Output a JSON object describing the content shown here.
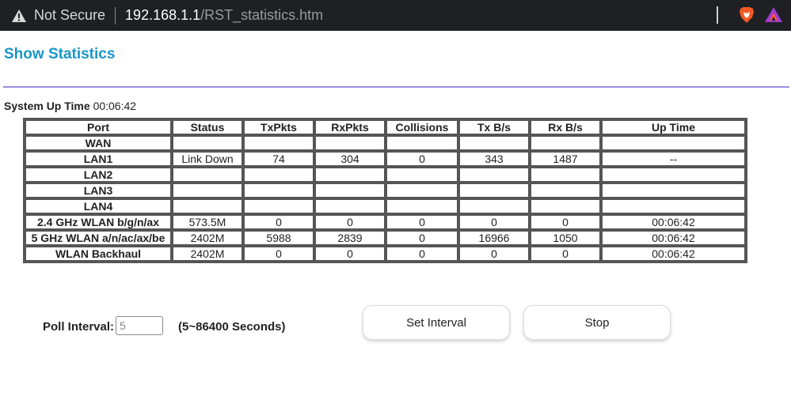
{
  "browser": {
    "security_label": "Not Secure",
    "url_host": "192.168.1.1",
    "url_path": "/RST_statistics.htm"
  },
  "page": {
    "title": "Show Statistics",
    "uptime_label": "System Up Time",
    "uptime_value": "00:06:42"
  },
  "table": {
    "headers": [
      "Port",
      "Status",
      "TxPkts",
      "RxPkts",
      "Collisions",
      "Tx B/s",
      "Rx B/s",
      "Up Time"
    ],
    "rows": [
      [
        "WAN",
        "",
        "",
        "",
        "",
        "",
        "",
        ""
      ],
      [
        "LAN1",
        "Link Down",
        "74",
        "304",
        "0",
        "343",
        "1487",
        "--"
      ],
      [
        "LAN2",
        "",
        "",
        "",
        "",
        "",
        "",
        ""
      ],
      [
        "LAN3",
        "",
        "",
        "",
        "",
        "",
        "",
        ""
      ],
      [
        "LAN4",
        "",
        "",
        "",
        "",
        "",
        "",
        ""
      ],
      [
        "2.4 GHz WLAN b/g/n/ax",
        "573.5M",
        "0",
        "0",
        "0",
        "0",
        "0",
        "00:06:42"
      ],
      [
        "5 GHz WLAN a/n/ac/ax/be",
        "2402M",
        "5988",
        "2839",
        "0",
        "16966",
        "1050",
        "00:06:42"
      ],
      [
        "WLAN Backhaul",
        "2402M",
        "0",
        "0",
        "0",
        "0",
        "0",
        "00:06:42"
      ]
    ]
  },
  "poll": {
    "label": "Poll Interval:",
    "value": "5",
    "range_text": "(5~86400 Seconds)"
  },
  "buttons": {
    "set_interval": "Set Interval",
    "stop": "Stop"
  }
}
